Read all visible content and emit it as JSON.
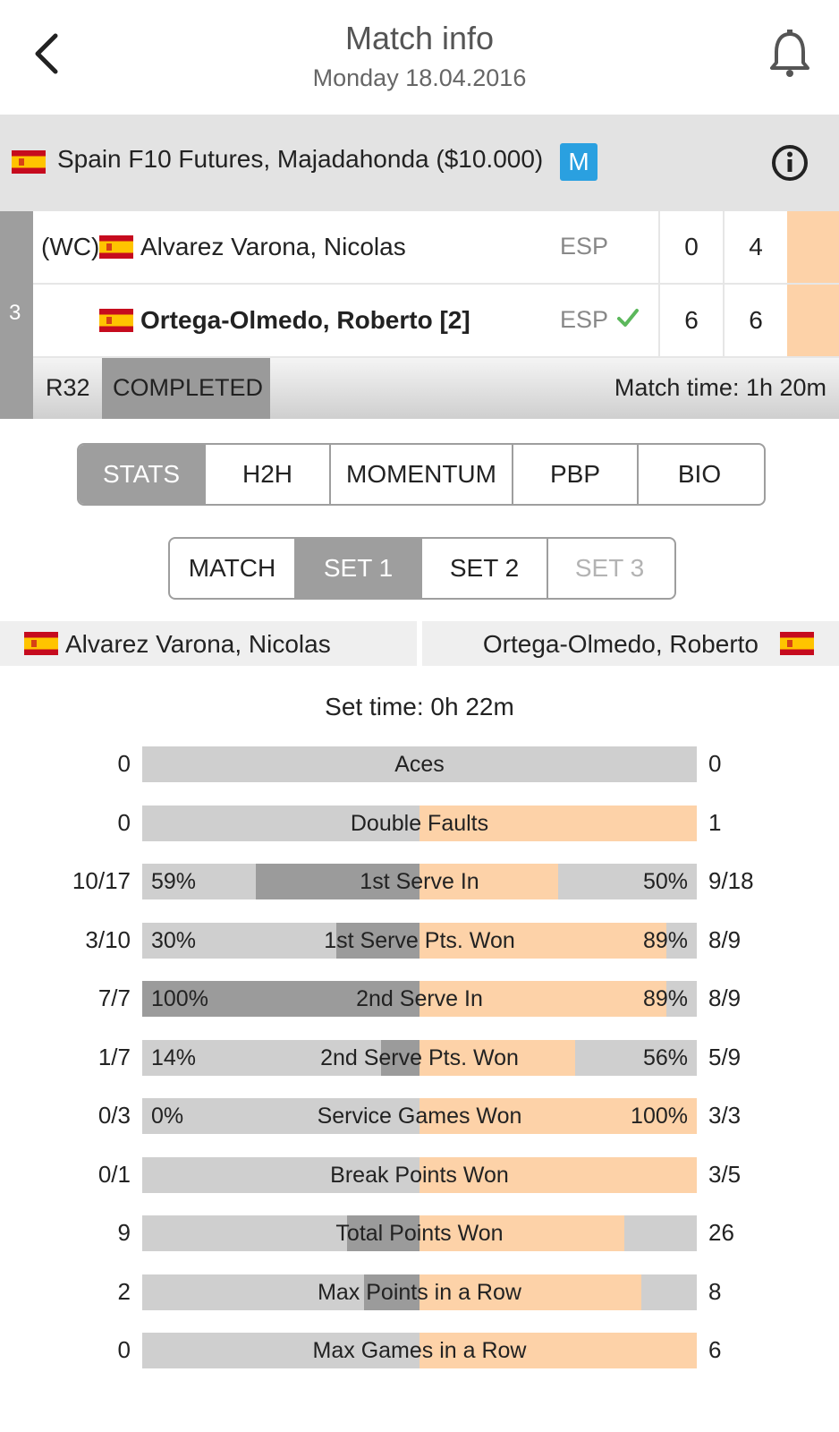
{
  "header": {
    "title": "Match info",
    "date": "Monday 18.04.2016"
  },
  "tournament": {
    "name": "Spain F10 Futures, Majadahonda ($10.000)",
    "badge": "M",
    "flag": "spain"
  },
  "match": {
    "court_number": "3",
    "players": [
      {
        "name": "Alvarez Varona, Nicolas",
        "prefix": "(WC)",
        "country": "ESP",
        "winner": false,
        "sets": [
          "0",
          "4"
        ]
      },
      {
        "name": "Ortega-Olmedo, Roberto [2]",
        "prefix": "",
        "country": "ESP",
        "winner": true,
        "sets": [
          "6",
          "6"
        ]
      }
    ],
    "round": "R32",
    "status": "COMPLETED",
    "match_time": "Match time: 1h 20m"
  },
  "tabs": [
    {
      "label": "STATS",
      "active": true
    },
    {
      "label": "H2H",
      "active": false
    },
    {
      "label": "MOMENTUM",
      "active": false
    },
    {
      "label": "PBP",
      "active": false
    },
    {
      "label": "BIO",
      "active": false
    }
  ],
  "set_tabs": [
    {
      "label": "MATCH",
      "active": false,
      "disabled": false
    },
    {
      "label": "SET 1",
      "active": true,
      "disabled": false
    },
    {
      "label": "SET 2",
      "active": false,
      "disabled": false
    },
    {
      "label": "SET 3",
      "active": false,
      "disabled": true
    }
  ],
  "stats_header": {
    "left_player": "Alvarez Varona, Nicolas",
    "right_player": "Ortega-Olmedo, Roberto"
  },
  "set_time": "Set time: 0h 22m",
  "colors": {
    "left_fill": "#9b9b9b",
    "right_fill": "#fdd2a8",
    "bar_bg": "#cfcfcf",
    "badge_blue": "#2aa0e0",
    "check_green": "#5cb85c"
  },
  "stats": [
    {
      "label": "Aces",
      "left": "0",
      "right": "0",
      "left_pct": "",
      "right_pct": "",
      "left_share": 0,
      "right_share": 0
    },
    {
      "label": "Double Faults",
      "left": "0",
      "right": "1",
      "left_pct": "",
      "right_pct": "",
      "left_share": 0,
      "right_share": 1
    },
    {
      "label": "1st Serve In",
      "left": "10/17",
      "right": "9/18",
      "left_pct": "59%",
      "right_pct": "50%",
      "left_share": 0.59,
      "right_share": 0.5
    },
    {
      "label": "1st Serve Pts. Won",
      "left": "3/10",
      "right": "8/9",
      "left_pct": "30%",
      "right_pct": "89%",
      "left_share": 0.3,
      "right_share": 0.89
    },
    {
      "label": "2nd Serve In",
      "left": "7/7",
      "right": "8/9",
      "left_pct": "100%",
      "right_pct": "89%",
      "left_share": 1.0,
      "right_share": 0.89
    },
    {
      "label": "2nd Serve Pts. Won",
      "left": "1/7",
      "right": "5/9",
      "left_pct": "14%",
      "right_pct": "56%",
      "left_share": 0.14,
      "right_share": 0.56
    },
    {
      "label": "Service Games Won",
      "left": "0/3",
      "right": "3/3",
      "left_pct": "0%",
      "right_pct": "100%",
      "left_share": 0,
      "right_share": 1.0
    },
    {
      "label": "Break Points Won",
      "left": "0/1",
      "right": "3/5",
      "left_pct": "",
      "right_pct": "",
      "left_share": 0,
      "right_share": 1.0
    },
    {
      "label": "Total Points Won",
      "left": "9",
      "right": "26",
      "left_pct": "",
      "right_pct": "",
      "left_share": 0.26,
      "right_share": 0.74
    },
    {
      "label": "Max Points in a Row",
      "left": "2",
      "right": "8",
      "left_pct": "",
      "right_pct": "",
      "left_share": 0.2,
      "right_share": 0.8
    },
    {
      "label": "Max Games in a Row",
      "left": "0",
      "right": "6",
      "left_pct": "",
      "right_pct": "",
      "left_share": 0,
      "right_share": 1.0
    }
  ]
}
